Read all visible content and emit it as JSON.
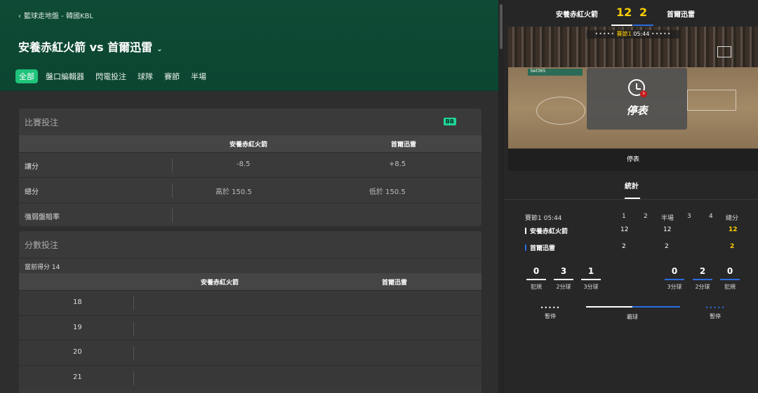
{
  "header": {
    "breadcrumb": "籃球走地盤 - 韓國KBL",
    "title": "安養赤紅火箭 vs 首爾迅雷",
    "tabs": [
      {
        "label": "全部",
        "active": true
      },
      {
        "label": "盤口編輯器",
        "active": false
      },
      {
        "label": "閃電投注",
        "active": false
      },
      {
        "label": "球隊",
        "active": false
      },
      {
        "label": "賽節",
        "active": false
      },
      {
        "label": "半場",
        "active": false
      }
    ]
  },
  "market1": {
    "title": "比賽投注",
    "badge": "BB",
    "col_home": "安養赤紅火箭",
    "col_away": "首爾迅雷",
    "rows": [
      {
        "label": "讓分",
        "home": "-8.5",
        "away": "+8.5"
      },
      {
        "label": "總分",
        "home": "高於 150.5",
        "away": "低於 150.5"
      },
      {
        "label": "強弱盤賠率",
        "home": "",
        "away": ""
      }
    ]
  },
  "market2": {
    "title": "分數投注",
    "sub": "當前得分 14",
    "col_home": "安養赤紅火箭",
    "col_away": "首爾迅雷",
    "rows": [
      "18",
      "19",
      "20",
      "21"
    ]
  },
  "scoreboard": {
    "home": "安養赤紅火箭",
    "away": "首爾迅雷",
    "home_score": "12",
    "away_score": "2"
  },
  "video": {
    "clock_dots_left": "•••••",
    "period": "賽節1",
    "time": "05:44",
    "clock_dots_right": "•••••",
    "ad": "bet365",
    "pause_label": "停表",
    "status": "停表"
  },
  "stats": {
    "tab": "統計",
    "head": {
      "period": "賽節1 05:44",
      "c1": "1",
      "c2": "2",
      "half": "半場",
      "c3": "3",
      "c4": "4",
      "total": "總分"
    },
    "home": {
      "name": "安養赤紅火箭",
      "q1": "12",
      "q2": "",
      "half": "12",
      "q3": "",
      "q4": "",
      "total": "12"
    },
    "away": {
      "name": "首爾迅雷",
      "q1": "2",
      "q2": "",
      "half": "2",
      "q3": "",
      "q4": "",
      "total": "2"
    },
    "home_mini": [
      {
        "v": "0",
        "l": "犯規"
      },
      {
        "v": "3",
        "l": "2分球"
      },
      {
        "v": "1",
        "l": "3分球"
      }
    ],
    "away_mini": [
      {
        "v": "0",
        "l": "3分球"
      },
      {
        "v": "2",
        "l": "2分球"
      },
      {
        "v": "0",
        "l": "犯規"
      }
    ],
    "timeouts_home_dots": "•••••",
    "timeouts_home_label": "暫停",
    "possession_label": "霸球",
    "timeouts_away_dots": "•••••",
    "timeouts_away_label": "暫停"
  },
  "colors": {
    "accent": "#1fc37a",
    "home": "#ffffff",
    "away": "#2a6de0",
    "score": "#ffcf00"
  }
}
